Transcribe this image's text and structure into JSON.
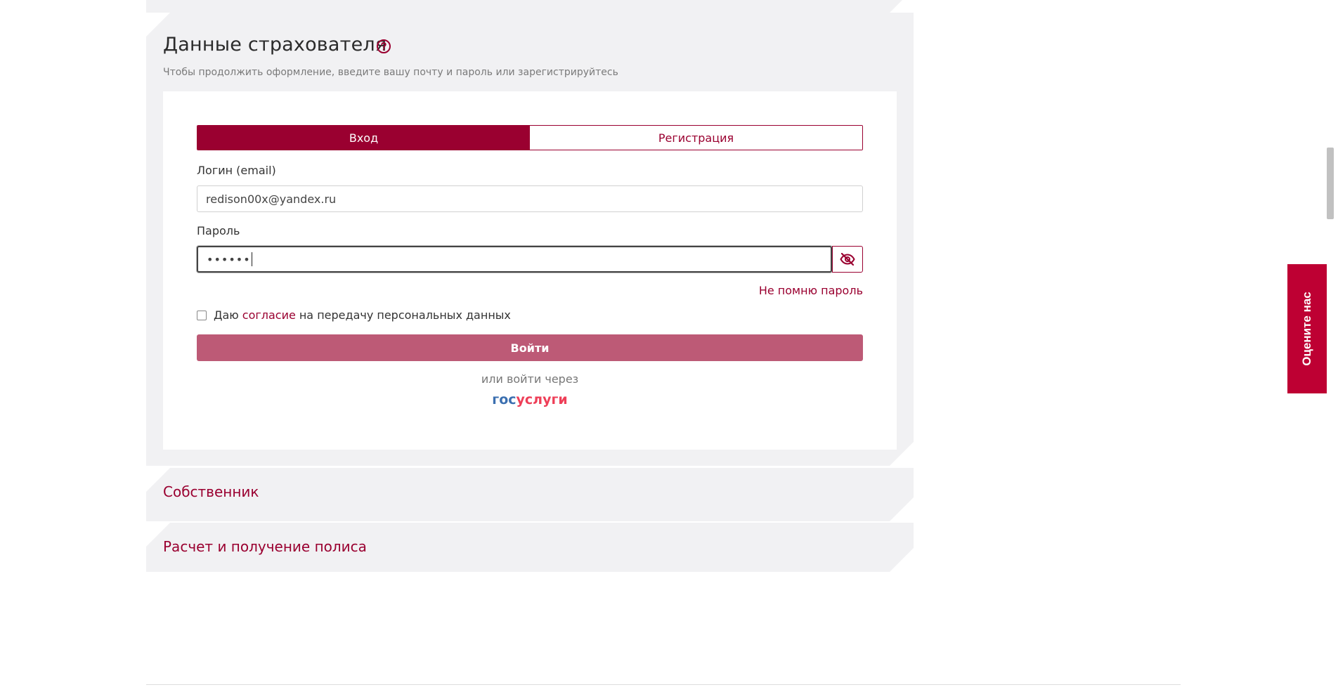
{
  "insurer_section": {
    "title": "Данные страхователя",
    "subtitle": "Чтобы продолжить оформление, введите вашу почту и пароль или зарегистрируйтесь",
    "tabs": [
      {
        "label": "Вход",
        "active": true
      },
      {
        "label": "Регистрация",
        "active": false
      }
    ],
    "login_label": "Логин (email)",
    "login_value": "redison00x@yandex.ru",
    "password_label": "Пароль",
    "password_mask": "••••••",
    "forgot_label": "Не помню пароль",
    "consent": {
      "prefix": "Даю",
      "link": "согласие",
      "suffix": "на передачу персональных данных",
      "checked": false
    },
    "submit_label": "Войти",
    "or_label": "или войти через",
    "gosuslugi": {
      "part1": "гос",
      "part2": "услуги"
    }
  },
  "owner_section": {
    "title": "Собственник"
  },
  "calc_section": {
    "title": "Расчет и получение полиса"
  },
  "feedback_tab": {
    "label": "Оцените нас"
  },
  "colors": {
    "brand": "#9a0030",
    "submit_disabled": "#bd5a76",
    "section_bg": "#f1f1f3",
    "feedback_bg": "#be0033",
    "gos_blue": "#3b6fb0",
    "gos_red": "#ee3f58"
  },
  "icons": {
    "help": "question-circle-icon",
    "password_toggle": "eye-slash-icon"
  }
}
